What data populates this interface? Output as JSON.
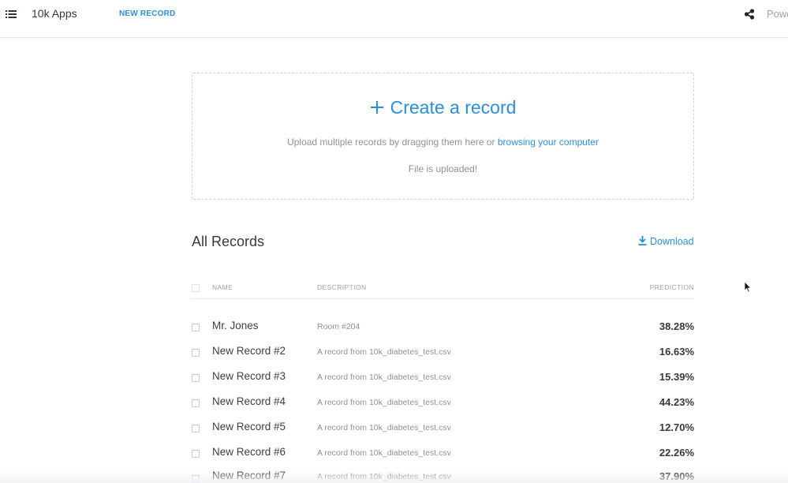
{
  "header": {
    "app_title": "10k Apps",
    "nav_label": "NEW RECORD",
    "powered_text": "Powe"
  },
  "dropzone": {
    "title": "Create a record",
    "upload_prefix": "Upload multiple records by dragging them here or ",
    "upload_link": "browsing your computer",
    "status": "File is uploaded!"
  },
  "records": {
    "title": "All Records",
    "download_label": "Download",
    "columns": {
      "name": "NAME",
      "description": "DESCRIPTION",
      "prediction": "PREDICTION"
    },
    "rows": [
      {
        "name": "Mr. Jones",
        "description": "Room #204",
        "prediction": "38.28%"
      },
      {
        "name": "New Record #2",
        "description": "A record from 10k_diabetes_test.csv",
        "prediction": "16.63%"
      },
      {
        "name": "New Record #3",
        "description": "A record from 10k_diabetes_test.csv",
        "prediction": "15.39%"
      },
      {
        "name": "New Record #4",
        "description": "A record from 10k_diabetes_test.csv",
        "prediction": "44.23%"
      },
      {
        "name": "New Record #5",
        "description": "A record from 10k_diabetes_test.csv",
        "prediction": "12.70%"
      },
      {
        "name": "New Record #6",
        "description": "A record from 10k_diabetes_test.csv",
        "prediction": "22.26%"
      },
      {
        "name": "New Record #7",
        "description": "A record from 10k_diabetes_test.csv",
        "prediction": "37.90%"
      }
    ]
  },
  "icons": {
    "menu": "list-menu-icon",
    "share": "share-icon",
    "plus": "plus-icon",
    "download": "download-icon",
    "cursor": "mouse-pointer-icon"
  },
  "colors": {
    "accent": "#2b8fd6",
    "text": "#333a40",
    "muted": "#8a939b"
  }
}
